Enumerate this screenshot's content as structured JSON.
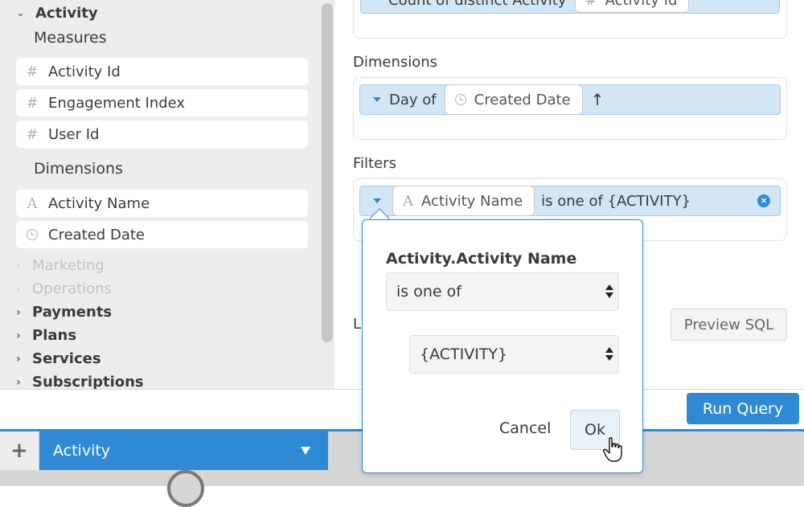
{
  "sidebar": {
    "cube_title": "Activity",
    "measures_label": "Measures",
    "measures": [
      {
        "icon": "hash-icon",
        "glyph": "#",
        "label": "Activity Id"
      },
      {
        "icon": "hash-icon",
        "glyph": "#",
        "label": "Engagement Index"
      },
      {
        "icon": "hash-icon",
        "glyph": "#",
        "label": "User Id"
      }
    ],
    "dimensions_label": "Dimensions",
    "dimensions": [
      {
        "icon": "string-icon",
        "glyph": "A",
        "label": "Activity Name"
      },
      {
        "icon": "clock-icon",
        "glyph": "",
        "label": "Created Date"
      }
    ],
    "cubes": [
      {
        "label": "Marketing",
        "disabled": true
      },
      {
        "label": "Operations",
        "disabled": true
      },
      {
        "label": "Payments",
        "disabled": false
      },
      {
        "label": "Plans",
        "disabled": false
      },
      {
        "label": "Services",
        "disabled": false
      },
      {
        "label": "Subscriptions",
        "disabled": false
      }
    ]
  },
  "query": {
    "measure_pill": {
      "prefix": "Count of distinct Activity",
      "chip": "Activity Id",
      "chip_glyph": "#"
    },
    "dimensions_label": "Dimensions",
    "dimension_pill": {
      "prefix": "Day of",
      "chip": "Created Date",
      "sort_glyph": "↑"
    },
    "filters_label": "Filters",
    "filter_pill": {
      "chip_glyph": "A",
      "chip": "Activity Name",
      "text": "is one of {ACTIVITY}",
      "remove_glyph": "×"
    },
    "limit_label_fragment": "L",
    "preview_sql": "Preview SQL",
    "run_query": "Run Query"
  },
  "popover": {
    "title": "Activity.Activity Name",
    "operator": "is one of",
    "value": "{ACTIVITY}",
    "cancel": "Cancel",
    "ok": "Ok"
  },
  "tabs": {
    "add_glyph": "+",
    "active": "Activity"
  },
  "colors": {
    "accent": "#2f8ad6",
    "pill_bg": "#d2e6f6",
    "sidebar_bg": "#ededed"
  }
}
